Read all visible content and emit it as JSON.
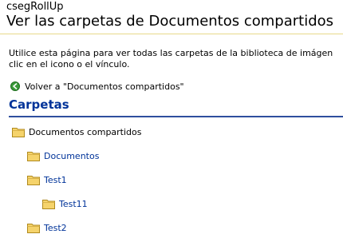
{
  "site": {
    "name": "csegRollUp"
  },
  "page": {
    "title": "Ver las carpetas de Documentos compartidos",
    "description_line1": "Utilice esta página para ver todas las carpetas de la biblioteca de imágen",
    "description_line2": "clic en el icono o el vínculo."
  },
  "nav": {
    "back_label": "Volver a \"Documentos compartidos\"",
    "back_icon": "green-circle-back-arrow-icon"
  },
  "section": {
    "title": "Carpetas"
  },
  "colors": {
    "section_title": "#003399",
    "link": "#003399",
    "section_rule": "#2e4e9e",
    "folder": "#f5d36b"
  },
  "tree": {
    "items": [
      {
        "label": "Documentos compartidos",
        "icon": "folder-icon"
      },
      {
        "label": "Documentos",
        "icon": "folder-icon"
      },
      {
        "label": "Test1",
        "icon": "folder-icon"
      },
      {
        "label": "Test11",
        "icon": "folder-icon"
      },
      {
        "label": "Test2",
        "icon": "folder-icon"
      }
    ]
  }
}
